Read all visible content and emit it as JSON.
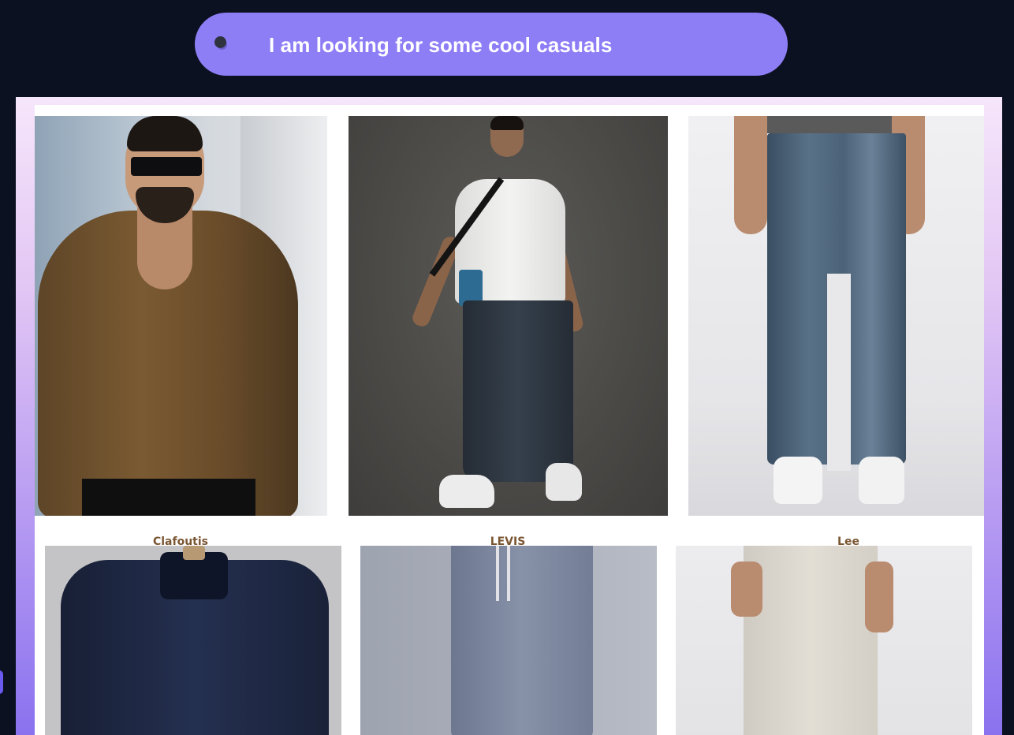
{
  "search": {
    "query": "I am looking for some cool casuals",
    "icon": "mic-dot-icon",
    "accent": "#8e7ef6"
  },
  "results": {
    "products": [
      {
        "image": "brown-textured-shirt-photo",
        "brand": "Clafoutis"
      },
      {
        "image": "white-tee-dark-jeans-photo",
        "brand": "LEVIS"
      },
      {
        "image": "blue-straight-jeans-photo",
        "brand": "Lee"
      },
      {
        "image": "navy-textured-shirt-photo"
      },
      {
        "image": "grey-track-pants-photo"
      },
      {
        "image": "beige-drawstring-pants-photo"
      }
    ]
  },
  "colors": {
    "background": "#0b1120",
    "brand_label": "#7a5632",
    "panel_gradient_top": "#f6e6fb",
    "panel_gradient_bottom": "#8a72ef"
  }
}
